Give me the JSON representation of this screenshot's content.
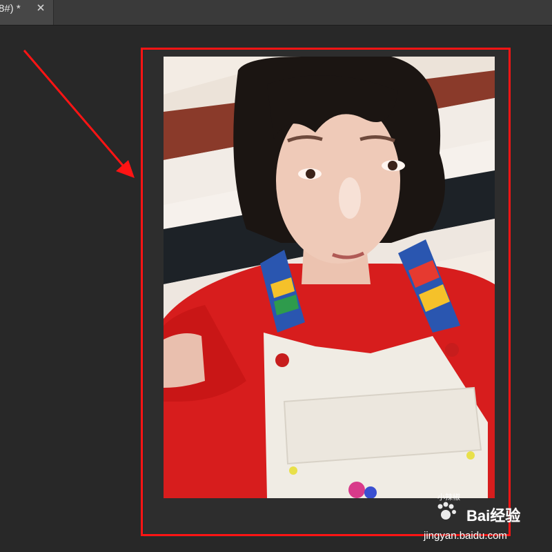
{
  "tab": {
    "title": "8#) *",
    "close_icon": "close-icon"
  },
  "colors": {
    "workspace": "#282828",
    "tab_bar": "#3a3a3a",
    "tab_active": "#474747",
    "highlight": "#ff1414",
    "annotation_arrow": "#ff1414"
  },
  "annotation": {
    "arrow_icon": "arrow-icon",
    "box": "highlight-box"
  },
  "watermark": {
    "small_text": "小辣椒",
    "brand": "Bai经验",
    "url": "jingyan.baidu.com",
    "paw_icon": "paw-icon"
  }
}
